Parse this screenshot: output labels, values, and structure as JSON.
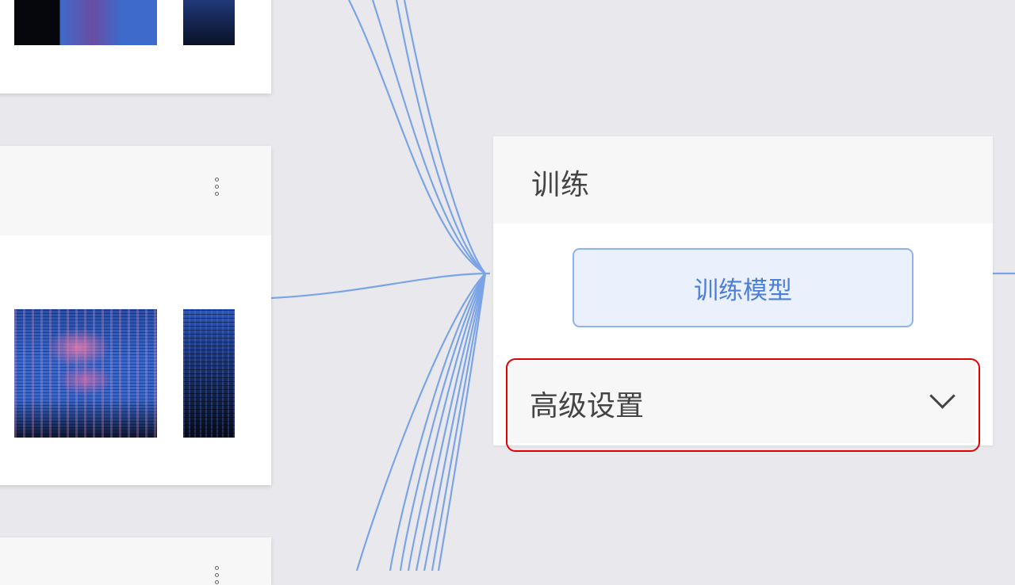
{
  "train_node": {
    "title": "训练",
    "train_button_label": "训练模型",
    "advanced_settings_label": "高级设置"
  },
  "colors": {
    "wire": "#7ba4e6",
    "accent": "#4c7fd5",
    "highlight": "#e00000"
  }
}
